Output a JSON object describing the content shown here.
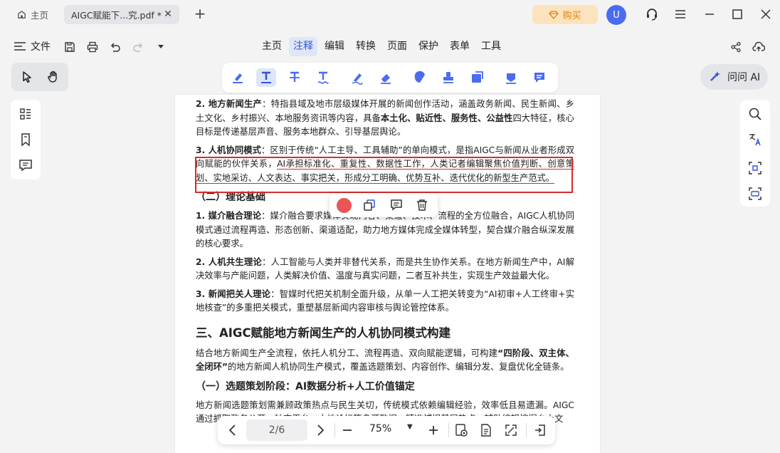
{
  "titlebar": {
    "home_tab": "主页",
    "file_tab": "AIGC赋能下...究.pdf *",
    "buy_label": "购买",
    "avatar_letter": "U"
  },
  "menubar": {
    "file_label": "文件",
    "tabs": [
      {
        "label": "主页"
      },
      {
        "label": "注释"
      },
      {
        "label": "编辑"
      },
      {
        "label": "转换"
      },
      {
        "label": "页面"
      },
      {
        "label": "保护"
      },
      {
        "label": "表单"
      },
      {
        "label": "工具"
      }
    ],
    "active_tab": "注释"
  },
  "ask_ai": {
    "label": "问问 AI"
  },
  "document": {
    "p1_title": "2. 地方新闻生产",
    "p1_text_a": "：特指县域及地市层级媒体开展的新闻创作活动，涵盖政务新闻、民生新闻、乡土文化、乡村振兴、本地服务资讯等内容，具备",
    "p1_bold": "本土化、贴近性、服务性、公益性",
    "p1_text_b": "四大特征，核心目标是传递基层声音、服务本地群众、引导基层舆论。",
    "p2_title": "3. 人机协同模式",
    "p2_text_a": "：区别于传统“人工主导、工具辅助”的单向模式，是指AIGC与新闻从业者形成双向赋能的伙伴关系，",
    "p2_text_b": "AI承担标准化、重复性、数据性工作，人类记者编辑聚焦价值判断、创意策划、实地采访、人文表达、事实把关，形成分工明确、优势互补、迭代优化的新型生产范式。",
    "h3_theory": "（二）理论基础",
    "t1_title": "1. 媒介融合理论",
    "t1_text": "：媒介融合要求媒体实现内容、渠道、技术、流程的全方位融合，AIGC人机协同模式通过流程再造、形态创新、渠道适配，助力地方媒体完成全媒体转型，契合媒介融合纵深发展的核心要求。",
    "t2_title": "2. 人机共生理论",
    "t2_text": "：人工智能与人类并非替代关系，而是共生协作关系。在地方新闻生产中，AI解决效率与产能问题，人类解决价值、温度与真实问题，二者互补共生，实现生产效益最大化。",
    "t3_title": "3. 新闻把关人理论",
    "t3_text": "：智媒时代把关机制全面升级，从单一人工把关转变为“AI初审+人工终审+实地核查”的多重把关模式，重塑基层新闻内容审核与舆论管控体系。",
    "h2_section": "三、AIGC赋能地方新闻生产的人机协同模式构建",
    "s_text_a": "结合地方新闻生产全流程，依托人机分工、流程再造、双向赋能逻辑，可构建",
    "s_bold": "“四阶段、双主体、全闭环”",
    "s_text_b": "的地方新闻人机协同生产模式，覆盖选题策划、内容创作、编辑分发、复盘优化全链条。",
    "h3_stage": "（一）选题策划阶段：AI数据分析+人工价值锚定",
    "last_text": "地方新闻选题策划需兼顾政策热点与民生关切，传统模式依赖编辑经验，效率低且易遗漏。AIGC通过抓取政务公开、社交平台、本地论坛等多源数据，精准捕捉基层热点，辅助编辑挖掘乡土文"
  },
  "bottom_bar": {
    "page_indicator": "2/6",
    "zoom": "75%"
  },
  "colors": {
    "accent": "#3356d8",
    "annotation_red": "#d72b2b",
    "popup_color": "#ea5656",
    "buy_bg": "#fde3bd",
    "avatar_bg": "#4a6cf1"
  }
}
